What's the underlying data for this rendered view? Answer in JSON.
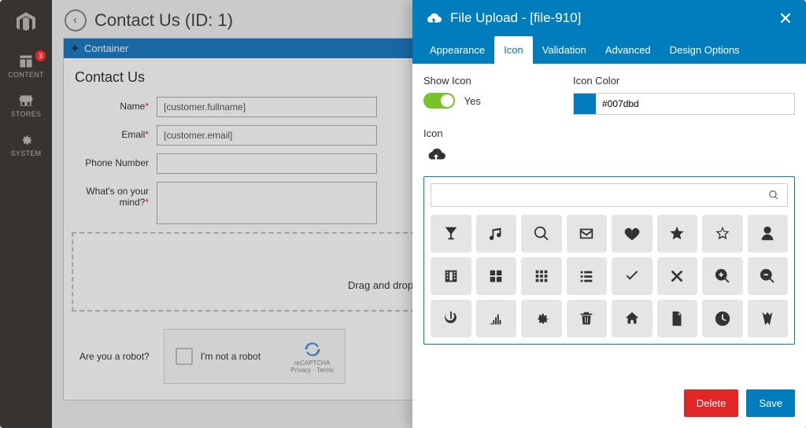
{
  "rail": {
    "items": [
      {
        "label": "CONTENT",
        "badge": "3"
      },
      {
        "label": "STORES"
      },
      {
        "label": "SYSTEM"
      }
    ]
  },
  "page": {
    "title": "Contact Us (ID: 1)"
  },
  "builder": {
    "container_label": "Container",
    "form_title": "Contact Us",
    "fields": {
      "name": {
        "label": "Name",
        "required": true,
        "value": "[customer.fullname]"
      },
      "email": {
        "label": "Email",
        "required": true,
        "value": "[customer.email]"
      },
      "phone": {
        "label": "Phone Number",
        "value": ""
      },
      "mind": {
        "label": "What's on your mind?",
        "required": true,
        "value": ""
      }
    },
    "dropzone": "Drag and drop files or click to select",
    "captcha": {
      "label": "Are you a robot?",
      "box": "I'm not a robot",
      "brand": "reCAPTCHA",
      "terms": "Privacy · Terms"
    }
  },
  "panel": {
    "title": "File Upload - [file-910]",
    "tabs": [
      "Appearance",
      "Icon",
      "Validation",
      "Advanced",
      "Design Options"
    ],
    "active_tab": "Icon",
    "show_icon": {
      "label": "Show Icon",
      "value": "Yes"
    },
    "icon_color": {
      "label": "Icon Color",
      "value": "#007dbd"
    },
    "icon_label": "Icon",
    "search_placeholder": "",
    "icons": [
      "glass",
      "music",
      "search",
      "envelope",
      "heart",
      "star",
      "star-o",
      "user",
      "film",
      "th-large",
      "th",
      "list",
      "check",
      "times",
      "zoom-in",
      "zoom-out",
      "power",
      "bars",
      "cog",
      "trash",
      "home",
      "file",
      "clock",
      "road"
    ],
    "buttons": {
      "delete": "Delete",
      "save": "Save"
    }
  }
}
